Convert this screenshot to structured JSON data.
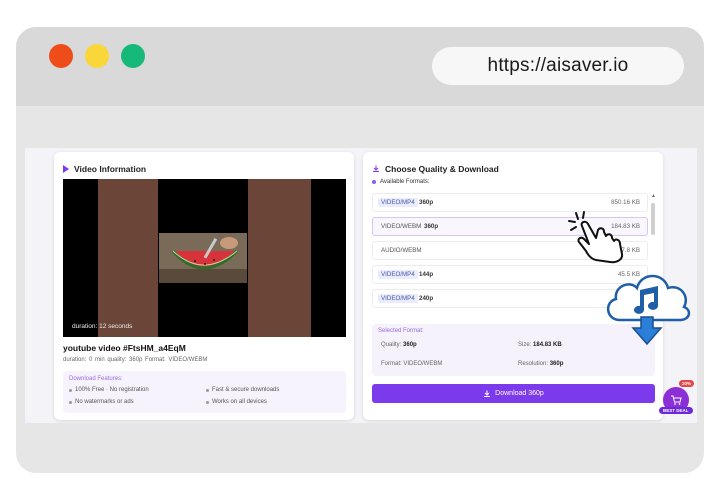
{
  "browser": {
    "url": "https://aisaver.io"
  },
  "video_card": {
    "title": "Video Information",
    "duration_overlay": "duration: 12 seconds",
    "video_title": "youtube video #FtsHM_a4EqM",
    "meta": "duration: 0 min   quality: 360p   Format: VIDEO/WEBM",
    "features_title": "Download Features:",
    "features": [
      "100% Free · No registration",
      "Fast & secure downloads",
      "No watermarks or ads",
      "Works on all devices"
    ]
  },
  "quality_card": {
    "title": "Choose Quality & Download",
    "available_label": "Available Formats:",
    "formats": [
      {
        "type": "VIDEO/MP4",
        "quality": "360p",
        "size": "850.16 KB",
        "selected": false
      },
      {
        "type": "VIDEO/WEBM",
        "quality": "360p",
        "size": "184.83 KB",
        "selected": true
      },
      {
        "type": "AUDIO/WEBM",
        "quality": "",
        "size": "197.8 KB",
        "selected": false
      },
      {
        "type": "VIDEO/MP4",
        "quality": "144p",
        "size": "45.5 KB",
        "selected": false
      },
      {
        "type": "VIDEO/MP4",
        "quality": "240p",
        "size": "",
        "selected": false
      }
    ],
    "selected_format": {
      "title": "Selected Format:",
      "quality_label": "Quality:",
      "quality_value": "360p",
      "size_label": "Size:",
      "size_value": "184.83 KB",
      "format_label": "Format:",
      "format_value": "VIDEO/WEBM",
      "resolution_label": "Resolution:",
      "resolution_value": "360p"
    },
    "download_button": "Download 360p"
  },
  "widget": {
    "badge": "20%",
    "label": "BEST DEAL"
  },
  "colors": {
    "accent": "#7c3aed",
    "red_dot": "#ee4d1b",
    "yellow_dot": "#fbd63a",
    "green_dot": "#17b978"
  },
  "icons": [
    "play-icon",
    "download-icon",
    "tap-hand-icon",
    "cloud-music-icon",
    "down-arrow-icon",
    "cart-icon"
  ]
}
